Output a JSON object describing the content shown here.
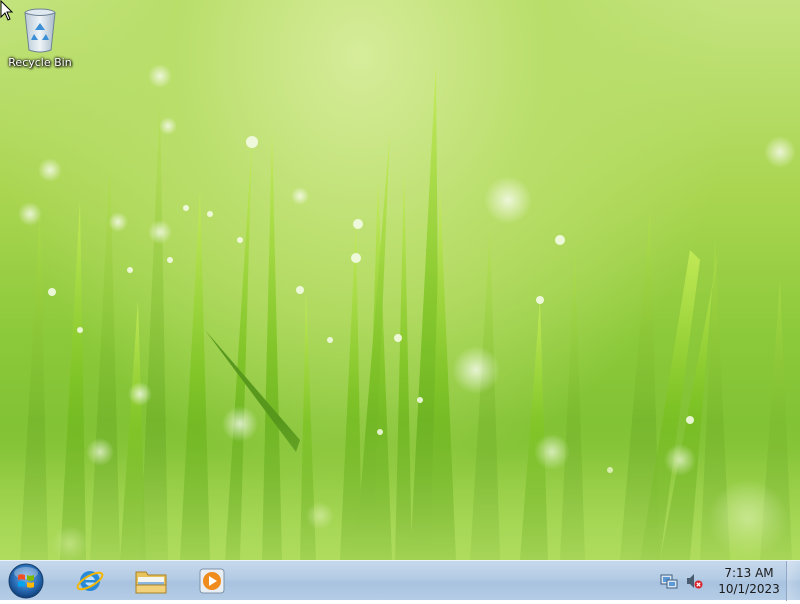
{
  "desktop": {
    "icons": [
      {
        "label": "Recycle Bin",
        "icon": "recycle-bin-icon"
      }
    ]
  },
  "taskbar": {
    "start": {
      "icon": "windows-start-icon"
    },
    "pinned": [
      {
        "icon": "internet-explorer-icon"
      },
      {
        "icon": "windows-explorer-icon"
      },
      {
        "icon": "windows-media-player-icon"
      }
    ],
    "tray": {
      "icons": [
        "network-icon",
        "volume-muted-icon"
      ],
      "time": "7:13 AM",
      "date": "10/1/2023"
    }
  },
  "colors": {
    "taskbar": "#b3cbe4",
    "wallpaper_green": "#8cc93a"
  }
}
